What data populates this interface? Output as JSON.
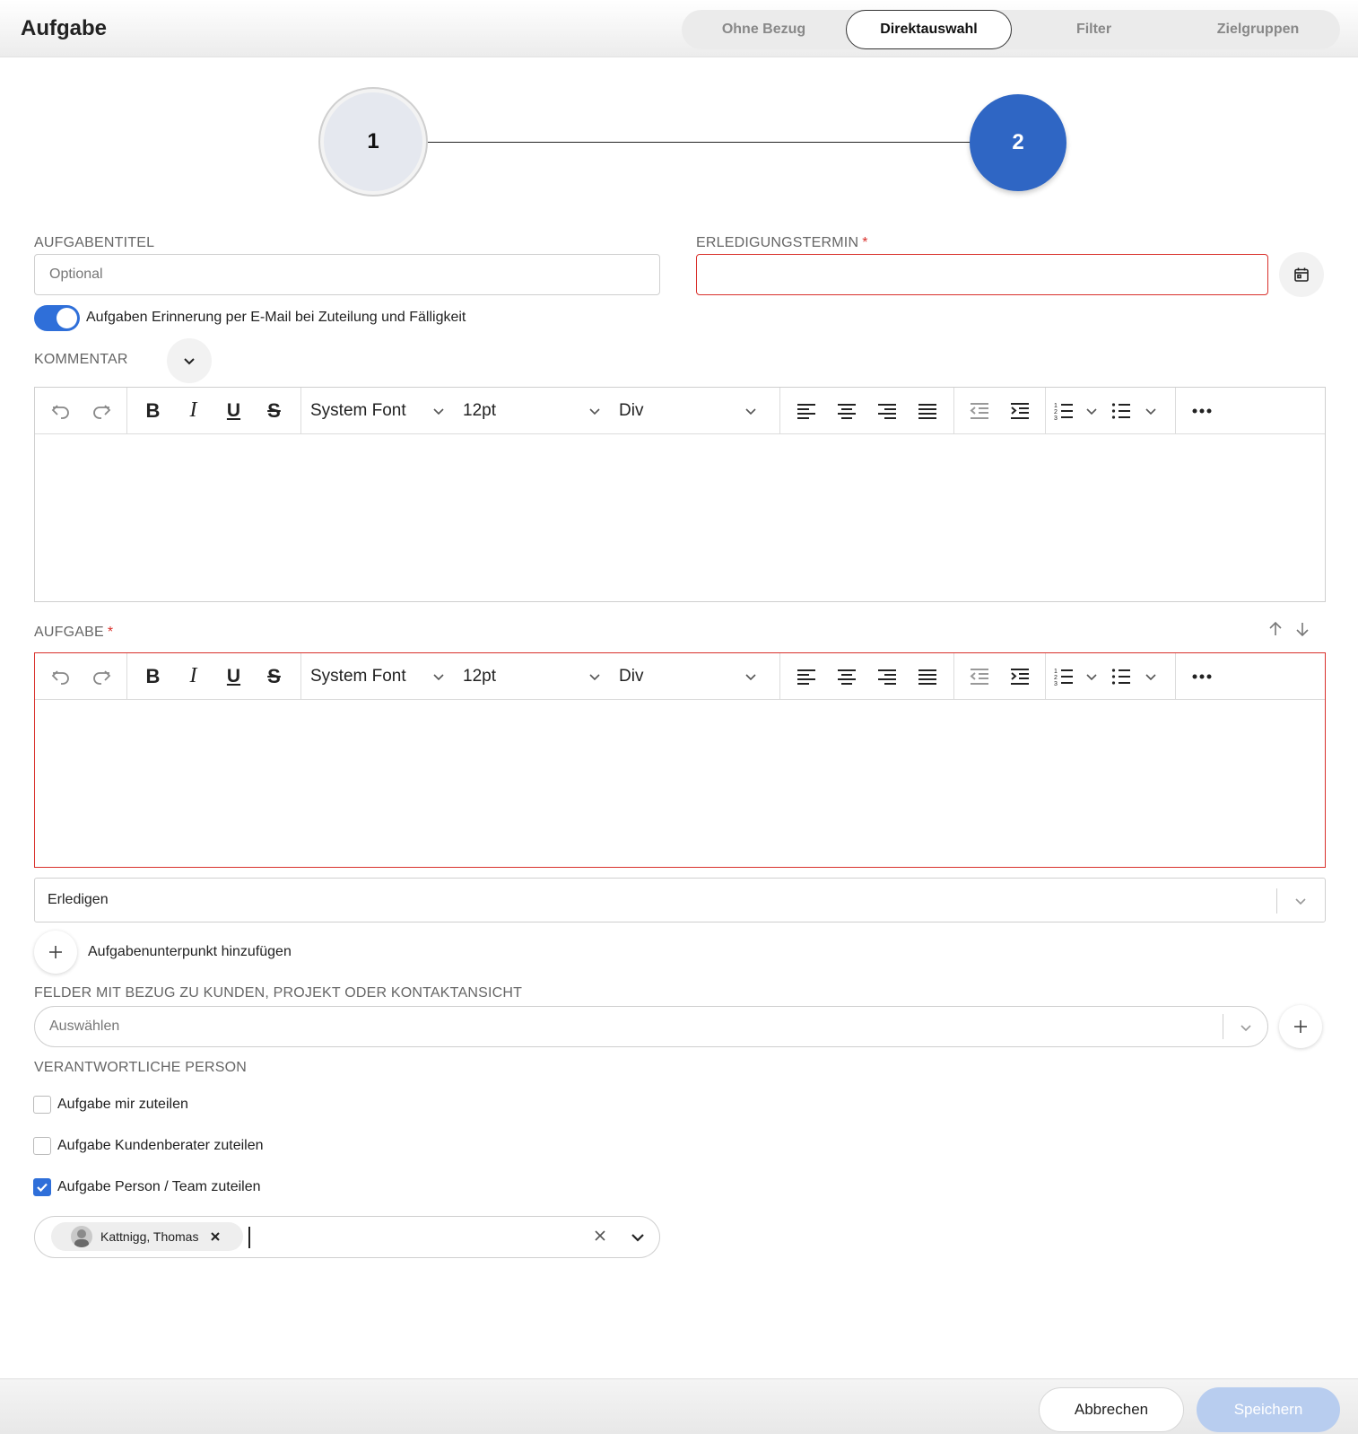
{
  "header": {
    "title": "Aufgabe",
    "tabs": [
      "Ohne Bezug",
      "Direktauswahl",
      "Filter",
      "Zielgruppen"
    ],
    "active_tab": "Direktauswahl"
  },
  "stepper": {
    "step1": "1",
    "step2": "2"
  },
  "fields": {
    "title_label": "AUFGABENTITEL",
    "title_placeholder": "Optional",
    "due_label": "ERLEDIGUNGSTERMIN",
    "required_mark": "*",
    "reminder_toggle_label": "Aufgaben Erinnerung per E-Mail bei Zuteilung und Fälligkeit",
    "comment_label": "KOMMENTAR",
    "task_label": "AUFGABE"
  },
  "editor_toolbar": {
    "font": "System Font",
    "size": "12pt",
    "block": "Div"
  },
  "status_select": {
    "value": "Erledigen"
  },
  "subtask": {
    "label": "Aufgabenunterpunkt hinzufügen"
  },
  "related_fields": {
    "label": "FELDER MIT BEZUG ZU KUNDEN, PROJEKT ODER KONTAKTANSICHT",
    "placeholder": "Auswählen"
  },
  "responsible": {
    "label": "VERANTWORTLICHE PERSON",
    "options": [
      {
        "label": "Aufgabe mir zuteilen",
        "checked": false
      },
      {
        "label": "Aufgabe Kundenberater zuteilen",
        "checked": false
      },
      {
        "label": "Aufgabe Person / Team zuteilen",
        "checked": true
      }
    ],
    "selected_person": "Kattnigg, Thomas"
  },
  "footer": {
    "cancel": "Abbrechen",
    "save": "Speichern"
  },
  "colors": {
    "accent": "#2f66c4",
    "error": "#d9302b",
    "save_disabled": "#b8cdef"
  }
}
